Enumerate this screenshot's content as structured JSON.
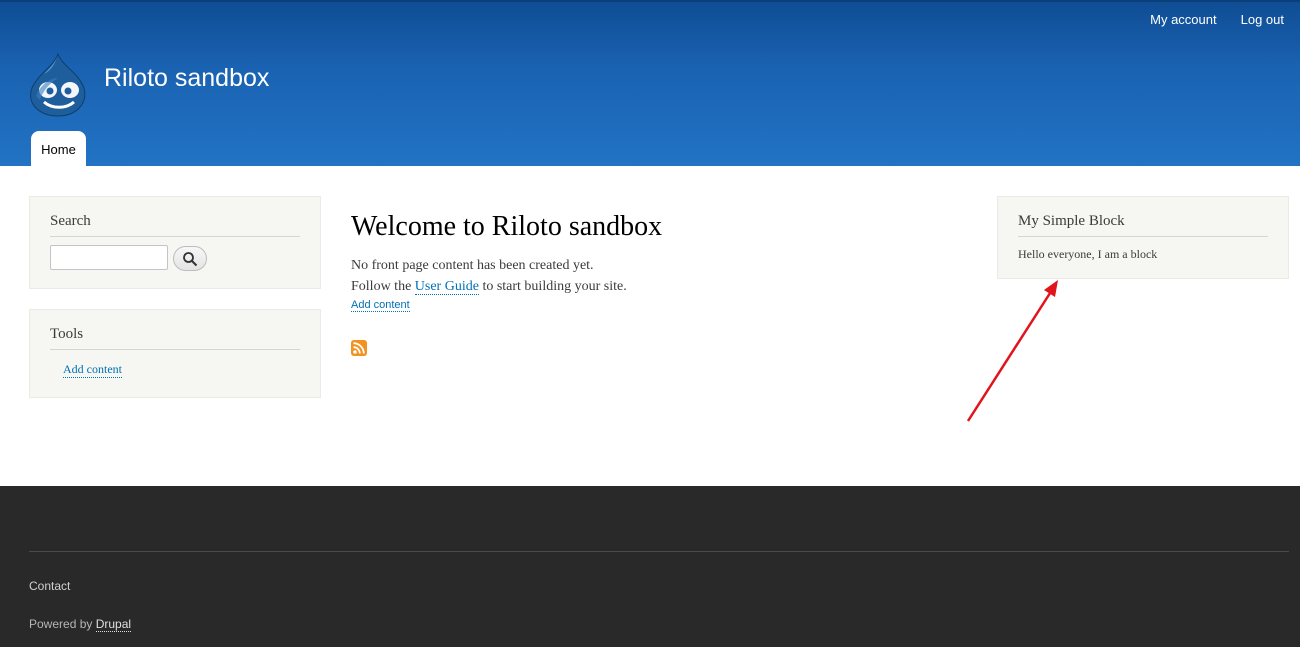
{
  "header": {
    "site_name": "Riloto sandbox",
    "secondary_menu": [
      "My account",
      "Log out"
    ],
    "main_menu": [
      "Home"
    ],
    "logo_icon": "drupal-drop-icon",
    "colors": {
      "header_top": "#0f4d94",
      "header_bottom": "#2273c4"
    }
  },
  "sidebar_first": {
    "search": {
      "title": "Search",
      "input_value": "",
      "button_icon": "search-icon"
    },
    "tools": {
      "title": "Tools",
      "links": [
        "Add content"
      ]
    }
  },
  "main": {
    "title": "Welcome to Riloto sandbox",
    "line1": "No front page content has been created yet.",
    "line2_prefix": "Follow the ",
    "line2_link": "User Guide",
    "line2_suffix": " to start building your site.",
    "add_content": "Add content",
    "feed_icon": "rss-icon"
  },
  "sidebar_second": {
    "title": "My Simple Block",
    "body": "Hello everyone, I am a block"
  },
  "annotation": {
    "arrow_color": "#e0141a"
  },
  "footer": {
    "contact": "Contact",
    "powered_prefix": "Powered by ",
    "powered_link": "Drupal",
    "background": "#292929"
  },
  "link_color": "#0071b3"
}
